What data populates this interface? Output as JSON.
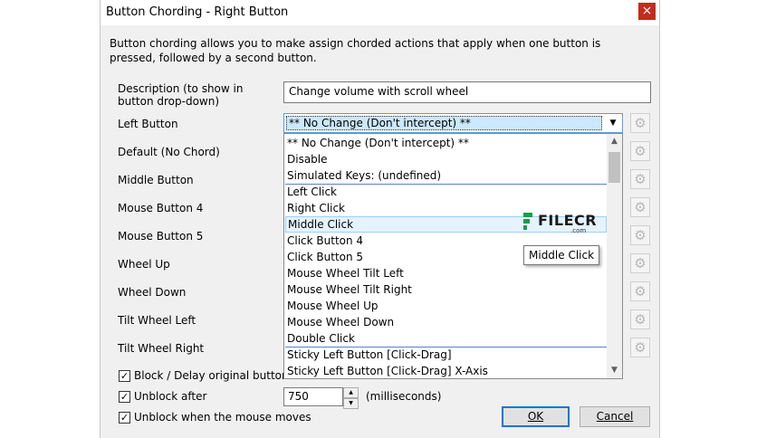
{
  "window": {
    "title": "Button Chording - Right Button",
    "close_glyph": "×"
  },
  "intro": "Button chording allows you to make assign chorded actions that apply when one button is pressed, followed by a second button.",
  "description": {
    "label": "Description (to show in button drop-down)",
    "value": "Change volume with scroll wheel"
  },
  "rows": {
    "left": "Left Button",
    "default": "Default (No Chord)",
    "middle": "Middle Button",
    "mb4": "Mouse Button 4",
    "mb5": "Mouse Button 5",
    "wheel_up": "Wheel Up",
    "wheel_down": "Wheel Down",
    "tilt_left": "Tilt Wheel Left",
    "tilt_right": "Tilt Wheel Right"
  },
  "combo": {
    "selected": "** No Change (Don't intercept) **",
    "arrow": "▼"
  },
  "dropdown": {
    "items": [
      "** No Change (Don't intercept) **",
      "Disable",
      "Simulated Keys: (undefined)",
      "Left Click",
      "Right Click",
      "Middle Click",
      "Click Button 4",
      "Click Button 5",
      "Mouse Wheel Tilt Left",
      "Mouse Wheel Tilt Right",
      "Mouse Wheel Up",
      "Mouse Wheel Down",
      "Double Click",
      "Sticky Left Button [Click-Drag]",
      "Sticky Left Button [Click-Drag] X-Axis"
    ],
    "highlighted": "Middle Click",
    "scroll_up": "▲",
    "scroll_down": "▼"
  },
  "tooltip": "Middle Click",
  "watermark": {
    "brand": "FILECR",
    "sub": ".com"
  },
  "options": {
    "block_delay": "Block / Delay original button action",
    "unblock_after": "Unblock after",
    "unblock_after_value": "750",
    "ms_unit": "(milliseconds)",
    "unblock_mouse": "Unblock when the mouse moves",
    "check": "✓"
  },
  "buttons": {
    "ok": "OK",
    "cancel": "Cancel"
  },
  "icons": {
    "gear": "⚙"
  }
}
